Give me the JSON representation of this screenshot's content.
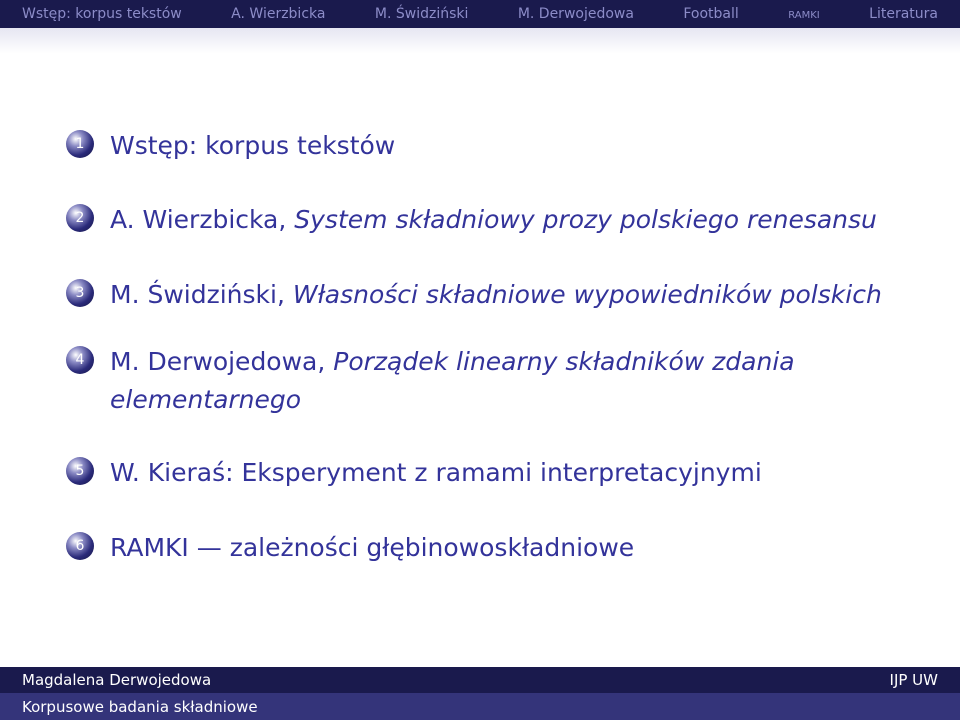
{
  "nav": {
    "items": [
      {
        "label": "Wstęp: korpus tekstów"
      },
      {
        "label": "A. Wierzbicka"
      },
      {
        "label": "M. Świdziński"
      },
      {
        "label": "M. Derwojedowa"
      },
      {
        "label": "Football"
      },
      {
        "label": "ramki"
      },
      {
        "label": "Literatura"
      }
    ]
  },
  "toc": {
    "items": [
      {
        "number": "1",
        "plain": "Wstęp: korpus tekstów",
        "italic": ""
      },
      {
        "number": "2",
        "plain": "A. Wierzbicka, ",
        "italic": "System składniowy prozy polskiego renesansu"
      },
      {
        "number": "3",
        "plain": "M. Świdziński, ",
        "italic": "Własności składniowe wypowiedników polskich"
      },
      {
        "number": "4",
        "plain": "M. Derwojedowa, ",
        "italic": "Porządek linearny składników zdania elementarnego"
      },
      {
        "number": "5",
        "plain": "W. Kieraś: Eksperyment z ramami interpretacyjnymi",
        "italic": ""
      },
      {
        "number": "6",
        "plain": "RAMKI — zależności głębinowoskładniowe",
        "italic": ""
      }
    ]
  },
  "footer": {
    "author": "Magdalena Derwojedowa",
    "institute": "IJP UW",
    "title": "Korpusowe badania składniowe"
  },
  "colors": {
    "bar_dark": "#1a1a4d",
    "bar_mid": "#34347a",
    "text_blue": "#33339a",
    "nav_inactive": "#8c8cc8"
  }
}
